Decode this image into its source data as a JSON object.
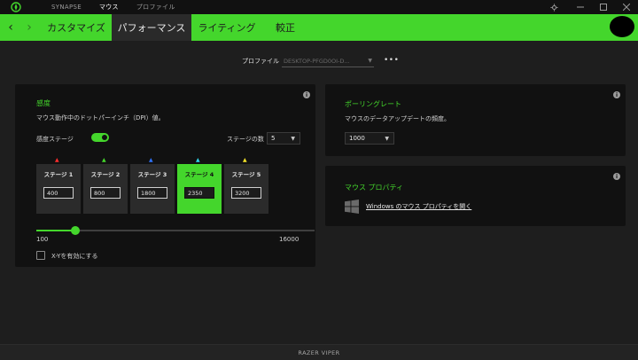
{
  "titlebar": {
    "nav": [
      "SYNAPSE",
      "マウス",
      "プロファイル"
    ],
    "active_nav": "マウス"
  },
  "tabs": {
    "items": [
      "カスタマイズ",
      "パフォーマンス",
      "ライティング",
      "較正"
    ],
    "active": "パフォーマンス"
  },
  "profile": {
    "label": "プロファイル",
    "value": "DESKTOP-PFGD0OI-D...",
    "more": "•••"
  },
  "sensitivity": {
    "title": "感度",
    "description": "マウス動作中のドットパーインチ（DPI）値。",
    "stages_label": "感度ステージ",
    "stages_enabled": true,
    "stage_count_label": "ステージの数",
    "stage_count_value": "5",
    "stages": [
      {
        "name": "ステージ 1",
        "value": "400",
        "color": "#ff2d2d"
      },
      {
        "name": "ステージ 2",
        "value": "800",
        "color": "#44d62c"
      },
      {
        "name": "ステージ 3",
        "value": "1800",
        "color": "#2f74ff"
      },
      {
        "name": "ステージ 4",
        "value": "2350",
        "color": "#2fd6e8"
      },
      {
        "name": "ステージ 5",
        "value": "3200",
        "color": "#f2e12a"
      }
    ],
    "active_stage_index": 3,
    "slider_min": "100",
    "slider_max": "16000",
    "slider_value_fraction": 0.14,
    "xy_label": "X-Yを有効にする"
  },
  "polling": {
    "title": "ポーリングレート",
    "description": "マウスのデータアップデートの頻度。",
    "value": "1000"
  },
  "mouse_properties": {
    "title": "マウス プロパティ",
    "link": "Windows のマウス プロパティを開く"
  },
  "footer": {
    "device": "RAZER VIPER"
  },
  "colors": {
    "accent": "#44d62c",
    "card": "#111111",
    "background": "#1e1e1e"
  }
}
